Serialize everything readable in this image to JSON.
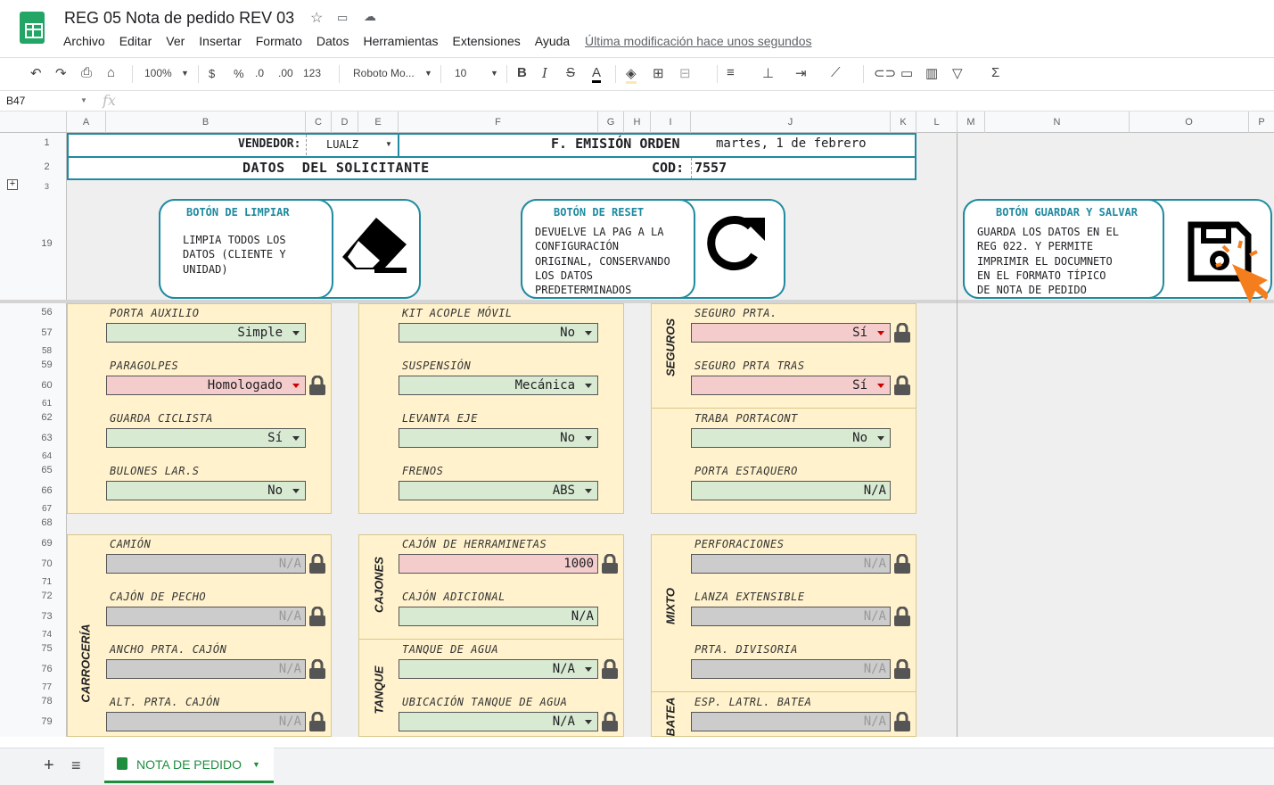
{
  "app": {
    "title": "REG 05 Nota de pedido REV 03",
    "menu": [
      "Archivo",
      "Editar",
      "Ver",
      "Insertar",
      "Formato",
      "Datos",
      "Herramientas",
      "Extensiones",
      "Ayuda"
    ],
    "last_modified": "Última modificación hace unos segundos"
  },
  "toolbar": {
    "zoom": "100%",
    "currency": "$",
    "percent": "%",
    "dec_less": ".0",
    "dec_more": ".00",
    "format": "123",
    "font": "Roboto Mo...",
    "size": "10"
  },
  "formula_bar": {
    "cell": "B47",
    "fx": "fx"
  },
  "columns": [
    "A",
    "B",
    "C",
    "D",
    "E",
    "F",
    "G",
    "H",
    "I",
    "J",
    "K",
    "L",
    "M",
    "N",
    "O",
    "P"
  ],
  "rows": [
    "1",
    "2",
    "3",
    "19",
    "56",
    "57",
    "58",
    "59",
    "60",
    "61",
    "62",
    "63",
    "64",
    "65",
    "66",
    "67",
    "68",
    "69",
    "70",
    "71",
    "72",
    "73",
    "74",
    "75",
    "76",
    "77",
    "78",
    "79"
  ],
  "header": {
    "vendedor_label": "VENDEDOR:",
    "vendedor_value": "LUALZ",
    "emision_label": "F. EMISIÓN ORDEN",
    "emision_value": "martes, 1 de febrero",
    "datos_label": "DATOS  DEL SOLICITANTE",
    "cod_label": "COD:",
    "cod_value": "7557"
  },
  "callouts": {
    "limpiar": {
      "title": "BOTÓN DE LIMPIAR",
      "text": "LIMPIA TODOS LOS\nDATOS (CLIENTE Y\nUNIDAD)"
    },
    "reset": {
      "title": "BOTÓN DE RESET",
      "text": "DEVUELVE LA PAG A LA\nCONFIGURACIÓN\nORIGINAL, CONSERVANDO\nLOS DATOS\nPREDETERMINADOS"
    },
    "guardar": {
      "title": "BOTÓN GUARDAR Y SALVAR",
      "text": "GUARDA LOS DATOS EN EL\nREG 022. Y PERMITE\nIMPRIMIR EL DOCUMNETO\nEN EL FORMATO TÍPICO\nDE NOTA DE PEDIDO"
    }
  },
  "section_labels": {
    "seguros": "SEGUROS",
    "carroceria": "CARROCERÍA",
    "cajones": "CAJONES",
    "tanque": "TANQUE",
    "mixto": "MIXTO",
    "batea": "BATEA"
  },
  "fields": {
    "porta_auxilio": {
      "label": "PORTA AUXILIO",
      "value": "Simple"
    },
    "paragolpes": {
      "label": "PARAGOLPES",
      "value": "Homologado"
    },
    "guarda_ciclista": {
      "label": "GUARDA CICLISTA",
      "value": "Sí"
    },
    "bulones": {
      "label": "BULONES LAR.S",
      "value": "No"
    },
    "kit_acople": {
      "label": "KIT ACOPLE MÓVIL",
      "value": "No"
    },
    "suspension": {
      "label": "SUSPENSIÓN",
      "value": "Mecánica"
    },
    "levanta_eje": {
      "label": "LEVANTA EJE",
      "value": "No"
    },
    "frenos": {
      "label": "FRENOS",
      "value": "ABS"
    },
    "seguro_prta": {
      "label": "SEGURO PRTA.",
      "value": "Sí"
    },
    "seguro_prta_tras": {
      "label": "SEGURO PRTA TRAS",
      "value": "Sí"
    },
    "traba_portacont": {
      "label": "TRABA PORTACONT",
      "value": "No"
    },
    "porta_estaquero": {
      "label": "PORTA ESTAQUERO",
      "value": "N/A"
    },
    "camion": {
      "label": "CAMIÓN",
      "value": "N/A"
    },
    "cajon_pecho": {
      "label": "CAJÓN DE PECHO",
      "value": "N/A"
    },
    "ancho_prta": {
      "label": "ANCHO PRTA. CAJÓN",
      "value": "N/A"
    },
    "alt_prta": {
      "label": "ALT. PRTA. CAJÓN",
      "value": "N/A"
    },
    "cajon_herr": {
      "label": "CAJÓN DE HERRAMINETAS",
      "value": "1000"
    },
    "cajon_adic": {
      "label": "CAJÓN ADICIONAL",
      "value": "N/A"
    },
    "tanque_agua": {
      "label": "TANQUE DE AGUA",
      "value": "N/A"
    },
    "ubic_tanque": {
      "label": "UBICACIÓN TANQUE DE AGUA",
      "value": "N/A"
    },
    "perforaciones": {
      "label": "PERFORACIONES",
      "value": "N/A"
    },
    "lanza": {
      "label": "LANZA EXTENSIBLE",
      "value": "N/A"
    },
    "prta_divisoria": {
      "label": "PRTA. DIVISORIA",
      "value": "N/A"
    },
    "esp_batea": {
      "label": "ESP. LATRL. BATEA",
      "value": "N/A"
    }
  },
  "sheet_tab": {
    "name": "NOTA DE PEDIDO"
  },
  "colors": {
    "accent": "#1f8aa0",
    "panel": "#fff2cc",
    "green": "#d9ead3",
    "red": "#f4cccc",
    "gray": "#cccccc",
    "sheets_green": "#1e8e3e"
  }
}
